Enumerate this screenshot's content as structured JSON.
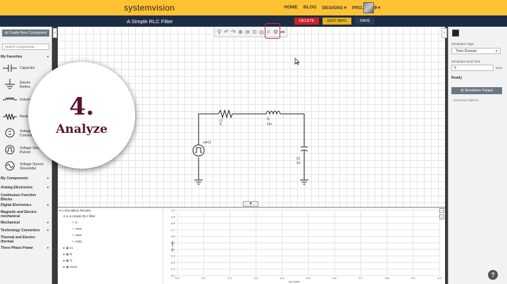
{
  "header": {
    "logo": "systemvision",
    "nav": [
      "HOME",
      "BLOG",
      "DESIGNS ▾",
      "PROJECTS ▾"
    ]
  },
  "titlebar": {
    "title": "A Simple RLC Filter",
    "delete": "DELETE",
    "edit_info": "EDIT INFO",
    "save": "SAVE"
  },
  "sidebar": {
    "create_button": "⊞ Create New Component",
    "search_placeholder": "Search Components...",
    "favorites_header": "My Favorites",
    "components": [
      {
        "label": "Capacitor",
        "icon": "capacitor-icon"
      },
      {
        "label": "Electrical Reference",
        "icon": "ground-icon"
      },
      {
        "label": "Inductor",
        "icon": "inductor-icon"
      },
      {
        "label": "Resistor",
        "icon": "resistor-icon"
      },
      {
        "label": "Voltage Source Constant",
        "icon": "dc-voltage-source-icon"
      },
      {
        "label": "Voltage Source Pulsed",
        "icon": "pulse-voltage-source-icon"
      },
      {
        "label": "Voltage Source Sinusoidal",
        "icon": "sine-voltage-source-icon"
      }
    ],
    "sections": [
      "My Components",
      "Analog Electronics",
      "Continuous Function Blocks",
      "Digital Electronics",
      "Magnetic and Electro-mechanical",
      "Mechanical",
      "Technology Converters",
      "Thermal and Electro-thermal",
      "Three Phase Power"
    ]
  },
  "schematic": {
    "r1": "r1",
    "r1_value": "5",
    "l1": "l1",
    "l1_value": "1m",
    "c1": "c1",
    "c1_value": "1u",
    "source": "vsrc1"
  },
  "right_panel": {
    "sim_type_label": "Simulation Type",
    "sim_type_value": "Time-Domain",
    "end_time_label": "Simulation End Time",
    "end_time_value": "5",
    "end_time_unit": "secs",
    "status": "Ready",
    "sim_output_button": "⊞ Simulation Output",
    "advanced_options": "Advanced Options"
  },
  "results_tree": {
    "root": "Simulation Results",
    "design": "a simple RLC filter",
    "nets": [
      "0",
      "net3",
      "net4",
      "net5"
    ],
    "components": [
      "c1",
      "l1",
      "r1",
      "vsrc1"
    ]
  },
  "chart_data": {
    "type": "line",
    "title": "",
    "xlabel": "No Units",
    "ylabel": "No Units",
    "xlim": [
      0,
      1.0
    ],
    "ylim": [
      0,
      1.0
    ],
    "x_ticks": [
      "0.0",
      "0.1",
      "0.2",
      "0.3",
      "0.4",
      "0.5",
      "0.6",
      "0.7",
      "0.8",
      "0.9",
      "1.0"
    ],
    "y_ticks": [
      "1.0",
      "0.9",
      "0.8",
      "0.7",
      "0.6",
      "0.5",
      "0.4",
      "0.3",
      "0.2",
      "0.1",
      "0.0"
    ],
    "grid": true,
    "series": []
  },
  "overlay": {
    "number": "4.",
    "word": "Analyze"
  },
  "colors": {
    "header": "#ffc233",
    "titlebar": "#1c2c46",
    "delete": "#cc2127",
    "edit_info": "#e8b11c",
    "save": "#2a3a56",
    "overlay_text": "#5a1530"
  }
}
